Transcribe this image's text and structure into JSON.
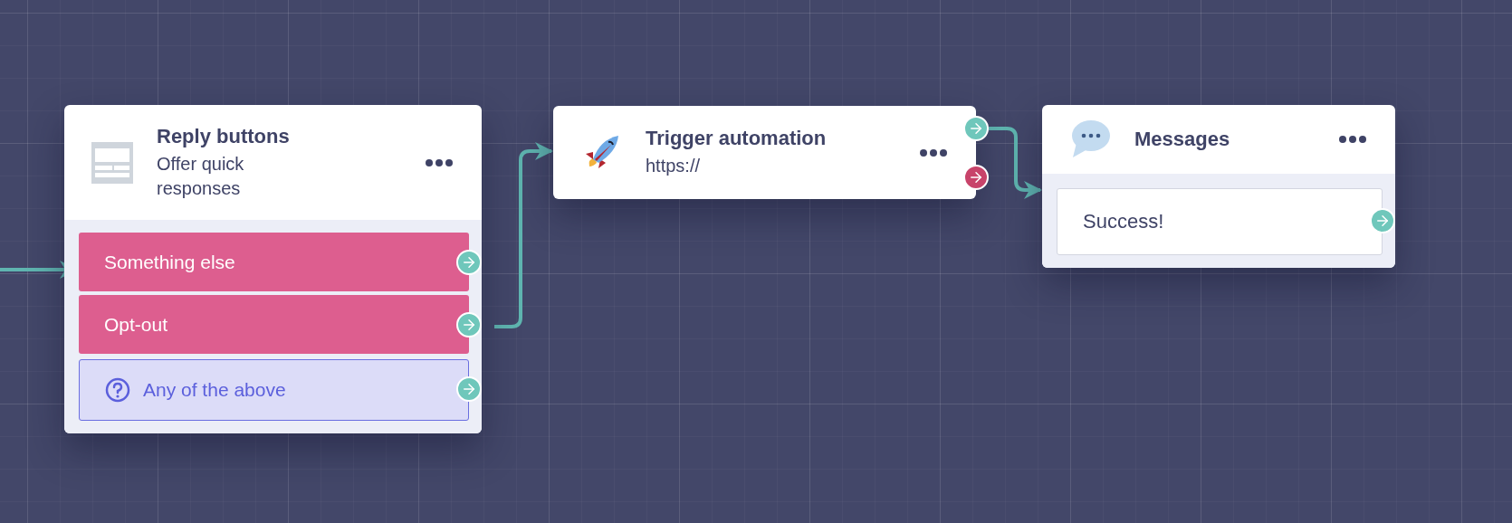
{
  "nodes": [
    {
      "kind": "reply",
      "title": "Reply buttons",
      "subtitle": "Offer quick responses",
      "options": [
        {
          "kind": "reply",
          "label": "Something else",
          "ports": [
            {
              "color": "#6fc7bb"
            }
          ]
        },
        {
          "kind": "reply",
          "label": "Opt-out",
          "ports": [
            {
              "color": "#6fc7bb"
            }
          ]
        },
        {
          "kind": "fallback",
          "label": "Any of the above",
          "ports": [
            {
              "color": "#6fc7bb"
            }
          ]
        }
      ]
    },
    {
      "kind": "automation",
      "title": "Trigger automation",
      "subtitle": "https://",
      "ports": [
        {
          "color": "#6fc7bb"
        },
        {
          "color": "#c8436a"
        }
      ]
    },
    {
      "kind": "messages",
      "title": "Messages",
      "options": [
        {
          "kind": "message",
          "label": "Success!",
          "ports": [
            {
              "color": "#6fc7bb"
            }
          ]
        }
      ]
    }
  ]
}
